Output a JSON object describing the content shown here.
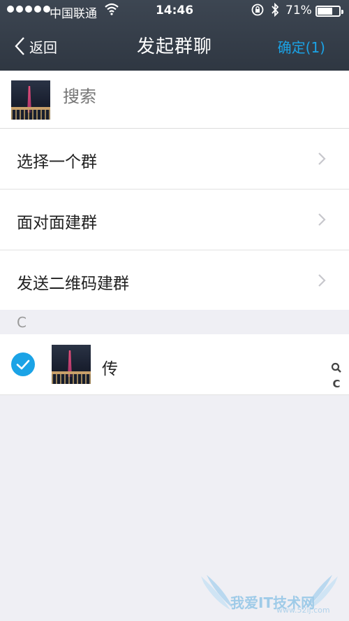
{
  "status_bar": {
    "carrier": "中国联通",
    "time": "14:46",
    "battery_percent": "71%",
    "battery_level": 0.71
  },
  "nav": {
    "back_label": "返回",
    "title": "发起群聊",
    "confirm_label": "确定(1)",
    "accent_color": "#1ba3e6"
  },
  "search": {
    "placeholder": "搜索"
  },
  "menu": {
    "items": [
      {
        "label": "选择一个群"
      },
      {
        "label": "面对面建群"
      },
      {
        "label": "发送二维码建群"
      }
    ]
  },
  "contacts": {
    "section_letter": "C",
    "items": [
      {
        "name": "传",
        "selected": true
      }
    ]
  },
  "index_bar": {
    "letter": "C"
  },
  "watermark": {
    "text": "我爱IT技术网",
    "url": "www.52ij.com"
  }
}
